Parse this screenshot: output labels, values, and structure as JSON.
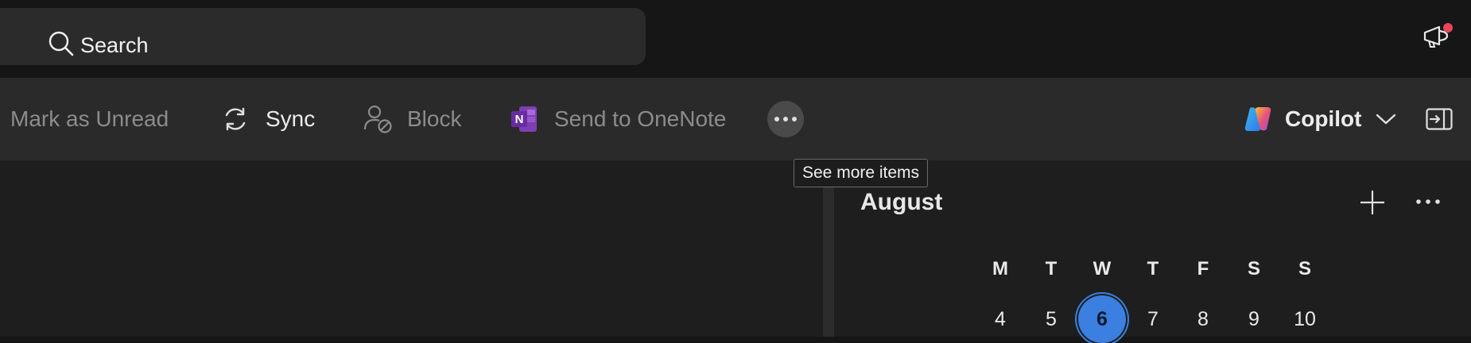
{
  "topbar": {
    "search_label": "Search",
    "search_icon": "search-icon",
    "notification_icon": "megaphone-icon",
    "notification_badge_color": "#e8465a"
  },
  "ribbon": {
    "items": [
      {
        "label": "Mark as Unread",
        "enabled": false
      },
      {
        "label": "Sync",
        "icon": "sync-icon",
        "enabled": true
      },
      {
        "label": "Block",
        "icon": "block-user-icon",
        "enabled": false
      },
      {
        "label": "Send to OneNote",
        "icon": "onenote-icon",
        "enabled": false
      }
    ],
    "more_tooltip": "See more items",
    "copilot_label": "Copilot",
    "copilot_icon": "copilot-icon",
    "panel_icon": "open-pane-icon"
  },
  "calendar": {
    "month": "August",
    "weekdays": [
      "M",
      "T",
      "W",
      "T",
      "F",
      "S",
      "S"
    ],
    "days": [
      "4",
      "5",
      "6",
      "7",
      "8",
      "9",
      "10"
    ],
    "today": "6",
    "accent_color": "#3b7fe0"
  }
}
